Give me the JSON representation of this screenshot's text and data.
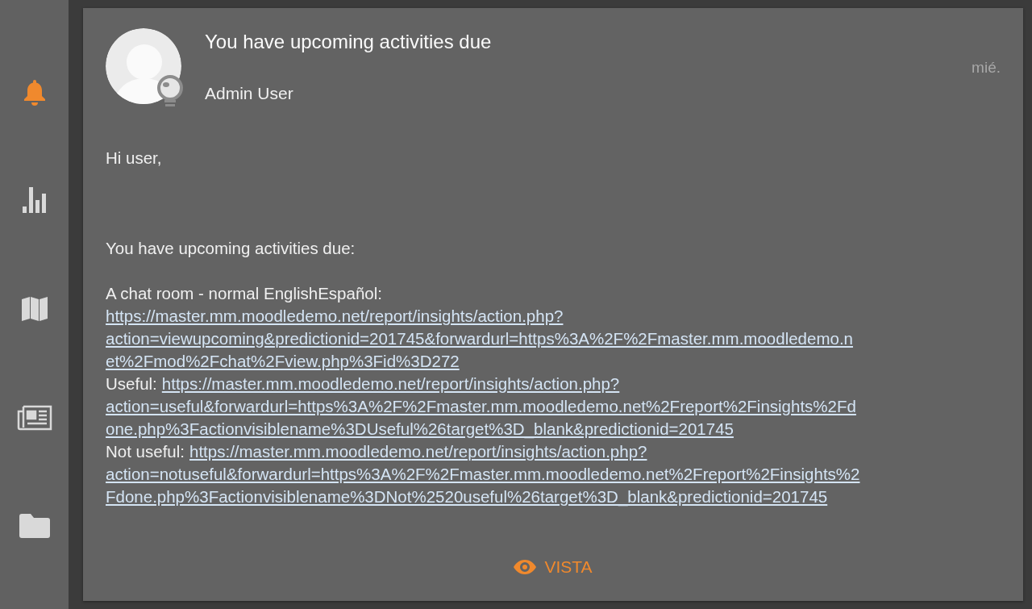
{
  "sidebar": {
    "items": [
      {
        "kind": "bell",
        "selected": true
      },
      {
        "kind": "chart",
        "selected": false
      },
      {
        "kind": "map",
        "selected": false
      },
      {
        "kind": "news",
        "selected": false
      },
      {
        "kind": "folder",
        "selected": false
      }
    ]
  },
  "notification": {
    "title": "You have upcoming activities due",
    "sender": "Admin User",
    "date": "mié.",
    "body": [
      {
        "kind": "text",
        "text": "Hi user,"
      },
      {
        "kind": "text",
        "text": "You have upcoming activities due:"
      },
      {
        "kind": "text",
        "text": "A chat room - normal EnglishEspañol:"
      },
      {
        "kind": "link",
        "link": "https://master.mm.moodledemo.net/report/insights/action.php?"
      },
      {
        "kind": "link",
        "link": "action=viewupcoming&predictionid=201745&forwardurl=https%3A%2F%2Fmaster.mm.moodledemo.n"
      },
      {
        "kind": "link",
        "link": "et%2Fmod%2Fchat%2Fview.php%3Fid%3D272"
      },
      {
        "kind": "link",
        "label": "Useful:",
        "link": "https://master.mm.moodledemo.net/report/insights/action.php?"
      },
      {
        "kind": "link",
        "link": "action=useful&forwardurl=https%3A%2F%2Fmaster.mm.moodledemo.net%2Freport%2Finsights%2Fd"
      },
      {
        "kind": "link",
        "link": "one.php%3Factionvisiblename%3DUseful%26target%3D_blank&predictionid=201745"
      },
      {
        "kind": "link",
        "label": "Not useful:",
        "link": "https://master.mm.moodledemo.net/report/insights/action.php?"
      },
      {
        "kind": "link",
        "link": "action=notuseful&forwardurl=https%3A%2F%2Fmaster.mm.moodledemo.net%2Freport%2Finsights%2"
      },
      {
        "kind": "link",
        "link": "Fdone.php%3Factionvisiblename%3DNot%2520useful%26target%3D_blank&predictionid=201745"
      }
    ],
    "action": "VISTA"
  }
}
